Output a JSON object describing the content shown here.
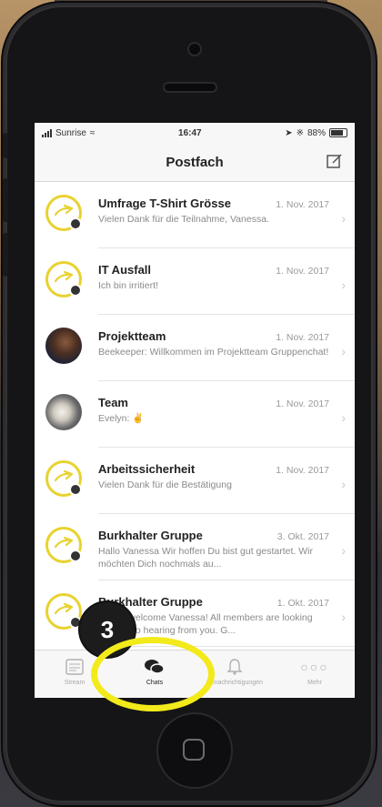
{
  "status_bar": {
    "carrier": "Sunrise",
    "time": "16:47",
    "battery": "88%"
  },
  "header": {
    "title": "Postfach"
  },
  "chats": [
    {
      "name": "Umfrage T-Shirt Grösse",
      "date": "1. Nov. 2017",
      "preview": "Vielen Dank für die Teilnahme, Vanessa.",
      "avatar": "logo"
    },
    {
      "name": "IT Ausfall",
      "date": "1. Nov. 2017",
      "preview": "Ich bin irritiert!",
      "avatar": "logo"
    },
    {
      "name": "Projektteam",
      "date": "1. Nov. 2017",
      "preview": "Beekeeper: Willkommen im Projektteam Gruppenchat!",
      "avatar": "photo"
    },
    {
      "name": "Team",
      "date": "1. Nov. 2017",
      "preview": "Evelyn: ✌",
      "avatar": "photo"
    },
    {
      "name": "Arbeitssicherheit",
      "date": "1. Nov. 2017",
      "preview": "Vielen Dank für die Bestätigung",
      "avatar": "logo"
    },
    {
      "name": "Burkhalter Gruppe",
      "date": "3. Okt. 2017",
      "preview": "Hallo Vanessa Wir hoffen Du bist gut gestartet. Wir möchten Dich nochmals au...",
      "avatar": "logo"
    },
    {
      "name": "Burkhalter Gruppe",
      "date": "1. Okt. 2017",
      "preview": "Hi and welcome Vanessa! All members are looking forward to hearing from you. G...",
      "avatar": "logo"
    }
  ],
  "tabs": [
    {
      "label": "Stream"
    },
    {
      "label": "Chats"
    },
    {
      "label": "Benachrichtigungen"
    },
    {
      "label": "Mehr"
    }
  ],
  "annotation": {
    "step": "3"
  },
  "colors": {
    "brand_yellow": "#e8d230",
    "highlight_yellow": "#f2ea1a"
  }
}
